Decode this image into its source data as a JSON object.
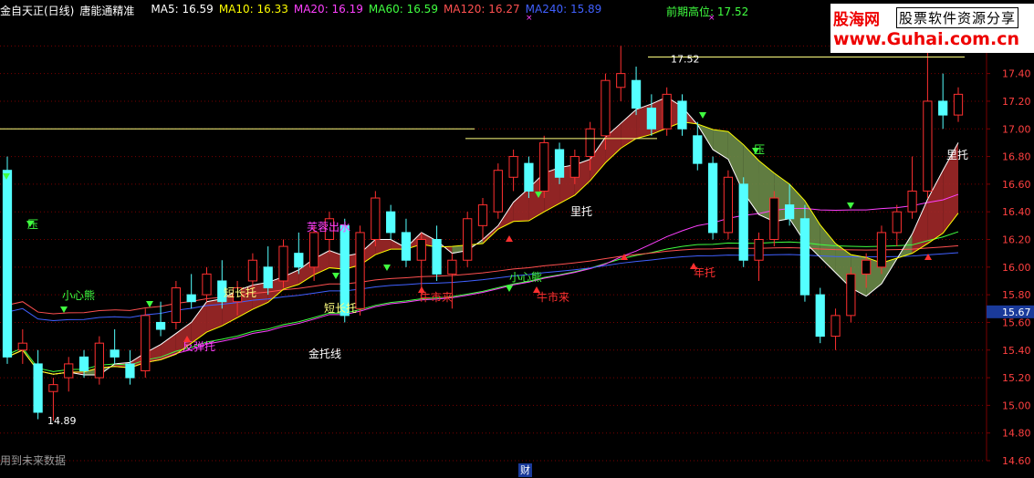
{
  "header": {
    "title": "金自天正(日线)",
    "indicator": "唐能通精准",
    "ma": [
      {
        "label": "MA5: 16.59",
        "color": "#ffffff"
      },
      {
        "label": "MA10: 16.33",
        "color": "#ffff00"
      },
      {
        "label": "MA20: 16.19",
        "color": "#ff40ff"
      },
      {
        "label": "MA60: 16.59",
        "color": "#40ff40"
      },
      {
        "label": "MA120: 16.27",
        "color": "#ff5050"
      },
      {
        "label": "MA240: 15.89",
        "color": "#4060ff"
      }
    ]
  },
  "prev_high_label": "前期高位: 17.52",
  "logo": {
    "line1": "股海网",
    "line1b": "股票软件资源分享",
    "line2": "www.Guhai.com.cn"
  },
  "footer_note": "用到未来数据",
  "finance_badge": "财",
  "current_price_tag": "15.67",
  "colors": {
    "up": "#ff3030",
    "down": "#54ffff",
    "bg": "#000000",
    "grid": "#7a0000"
  },
  "chart_data": {
    "type": "candlestick",
    "ylim": [
      14.6,
      17.8
    ],
    "y_ticks": [
      "17.60",
      "17.40",
      "17.20",
      "17.00",
      "16.80",
      "16.60",
      "16.40",
      "16.20",
      "16.00",
      "15.80",
      "15.60",
      "15.40",
      "15.20",
      "15.00",
      "14.80",
      "14.60"
    ],
    "candles": [
      [
        16.7,
        16.8,
        15.3,
        15.35
      ],
      [
        15.4,
        15.55,
        15.3,
        15.45
      ],
      [
        15.3,
        15.4,
        14.9,
        14.95
      ],
      [
        15.1,
        15.2,
        14.89,
        15.15
      ],
      [
        15.2,
        15.35,
        15.1,
        15.3
      ],
      [
        15.35,
        15.4,
        15.2,
        15.25
      ],
      [
        15.2,
        15.5,
        15.15,
        15.45
      ],
      [
        15.4,
        15.55,
        15.3,
        15.35
      ],
      [
        15.3,
        15.4,
        15.15,
        15.2
      ],
      [
        15.25,
        15.7,
        15.2,
        15.65
      ],
      [
        15.6,
        15.75,
        15.5,
        15.55
      ],
      [
        15.6,
        15.9,
        15.55,
        15.85
      ],
      [
        15.8,
        15.95,
        15.7,
        15.75
      ],
      [
        15.8,
        16.0,
        15.75,
        15.95
      ],
      [
        15.9,
        16.05,
        15.7,
        15.75
      ],
      [
        15.75,
        15.9,
        15.65,
        15.85
      ],
      [
        15.9,
        16.1,
        15.85,
        16.05
      ],
      [
        16.0,
        16.15,
        15.8,
        15.85
      ],
      [
        15.9,
        16.2,
        15.85,
        16.15
      ],
      [
        16.1,
        16.25,
        15.95,
        16.0
      ],
      [
        16.0,
        16.3,
        15.9,
        16.25
      ],
      [
        16.2,
        16.4,
        16.1,
        16.35
      ],
      [
        16.3,
        16.35,
        15.6,
        15.65
      ],
      [
        15.7,
        16.3,
        15.65,
        16.25
      ],
      [
        16.2,
        16.55,
        16.15,
        16.5
      ],
      [
        16.4,
        16.45,
        16.2,
        16.25
      ],
      [
        16.25,
        16.35,
        16.0,
        16.05
      ],
      [
        16.05,
        16.25,
        15.75,
        16.2
      ],
      [
        16.2,
        16.3,
        15.9,
        15.95
      ],
      [
        15.95,
        16.1,
        15.7,
        16.05
      ],
      [
        16.05,
        16.4,
        16.0,
        16.35
      ],
      [
        16.3,
        16.5,
        16.2,
        16.45
      ],
      [
        16.4,
        16.75,
        16.35,
        16.7
      ],
      [
        16.65,
        16.85,
        16.55,
        16.8
      ],
      [
        16.75,
        16.8,
        16.5,
        16.55
      ],
      [
        16.55,
        16.95,
        16.5,
        16.9
      ],
      [
        16.85,
        16.9,
        16.6,
        16.65
      ],
      [
        16.65,
        16.85,
        16.6,
        16.8
      ],
      [
        16.8,
        17.05,
        16.7,
        17.0
      ],
      [
        16.95,
        17.4,
        16.85,
        17.35
      ],
      [
        17.3,
        17.6,
        17.2,
        17.4
      ],
      [
        17.35,
        17.45,
        17.1,
        17.15
      ],
      [
        17.15,
        17.25,
        16.95,
        17.0
      ],
      [
        17.0,
        17.3,
        16.95,
        17.25
      ],
      [
        17.2,
        17.25,
        16.95,
        17.0
      ],
      [
        16.95,
        17.05,
        16.7,
        16.75
      ],
      [
        16.75,
        16.8,
        16.2,
        16.25
      ],
      [
        16.25,
        16.7,
        16.2,
        16.65
      ],
      [
        16.6,
        16.65,
        16.0,
        16.05
      ],
      [
        16.05,
        16.25,
        15.9,
        16.2
      ],
      [
        16.2,
        16.55,
        16.15,
        16.5
      ],
      [
        16.45,
        16.6,
        16.3,
        16.35
      ],
      [
        16.35,
        16.45,
        15.75,
        15.8
      ],
      [
        15.8,
        15.85,
        15.45,
        15.5
      ],
      [
        15.5,
        15.7,
        15.4,
        15.65
      ],
      [
        15.65,
        16.0,
        15.6,
        15.95
      ],
      [
        15.95,
        16.1,
        15.85,
        16.05
      ],
      [
        16.0,
        16.3,
        15.95,
        16.25
      ],
      [
        16.25,
        16.45,
        16.15,
        16.4
      ],
      [
        16.4,
        16.8,
        16.35,
        16.55
      ],
      [
        16.55,
        17.8,
        16.5,
        17.2
      ],
      [
        17.2,
        17.4,
        17.0,
        17.1
      ],
      [
        17.1,
        17.3,
        17.05,
        17.25
      ]
    ],
    "prev_high_value": 17.52,
    "low_annotation": "14.89",
    "high_annotation": "17.52",
    "annotations": [
      {
        "text": "小心熊",
        "color": "#40ff40"
      },
      {
        "text": "反弹托",
        "color": "#ff40ff"
      },
      {
        "text": "短长托",
        "color": "#ffff80"
      },
      {
        "text": "短长托",
        "color": "#ffff80"
      },
      {
        "text": "芙蓉出水",
        "color": "#ff40ff"
      },
      {
        "text": "金托线",
        "color": "#ffffff"
      },
      {
        "text": "牛市来",
        "color": "#ff3030"
      },
      {
        "text": "牛市来",
        "color": "#ff3030"
      },
      {
        "text": "小心熊",
        "color": "#40ff40"
      },
      {
        "text": "里托",
        "color": "#ffffff"
      },
      {
        "text": "年托",
        "color": "#ff3030"
      },
      {
        "text": "压",
        "color": "#40ff40"
      },
      {
        "text": "压",
        "color": "#40ff40"
      },
      {
        "text": "里托",
        "color": "#ffffff"
      }
    ]
  }
}
